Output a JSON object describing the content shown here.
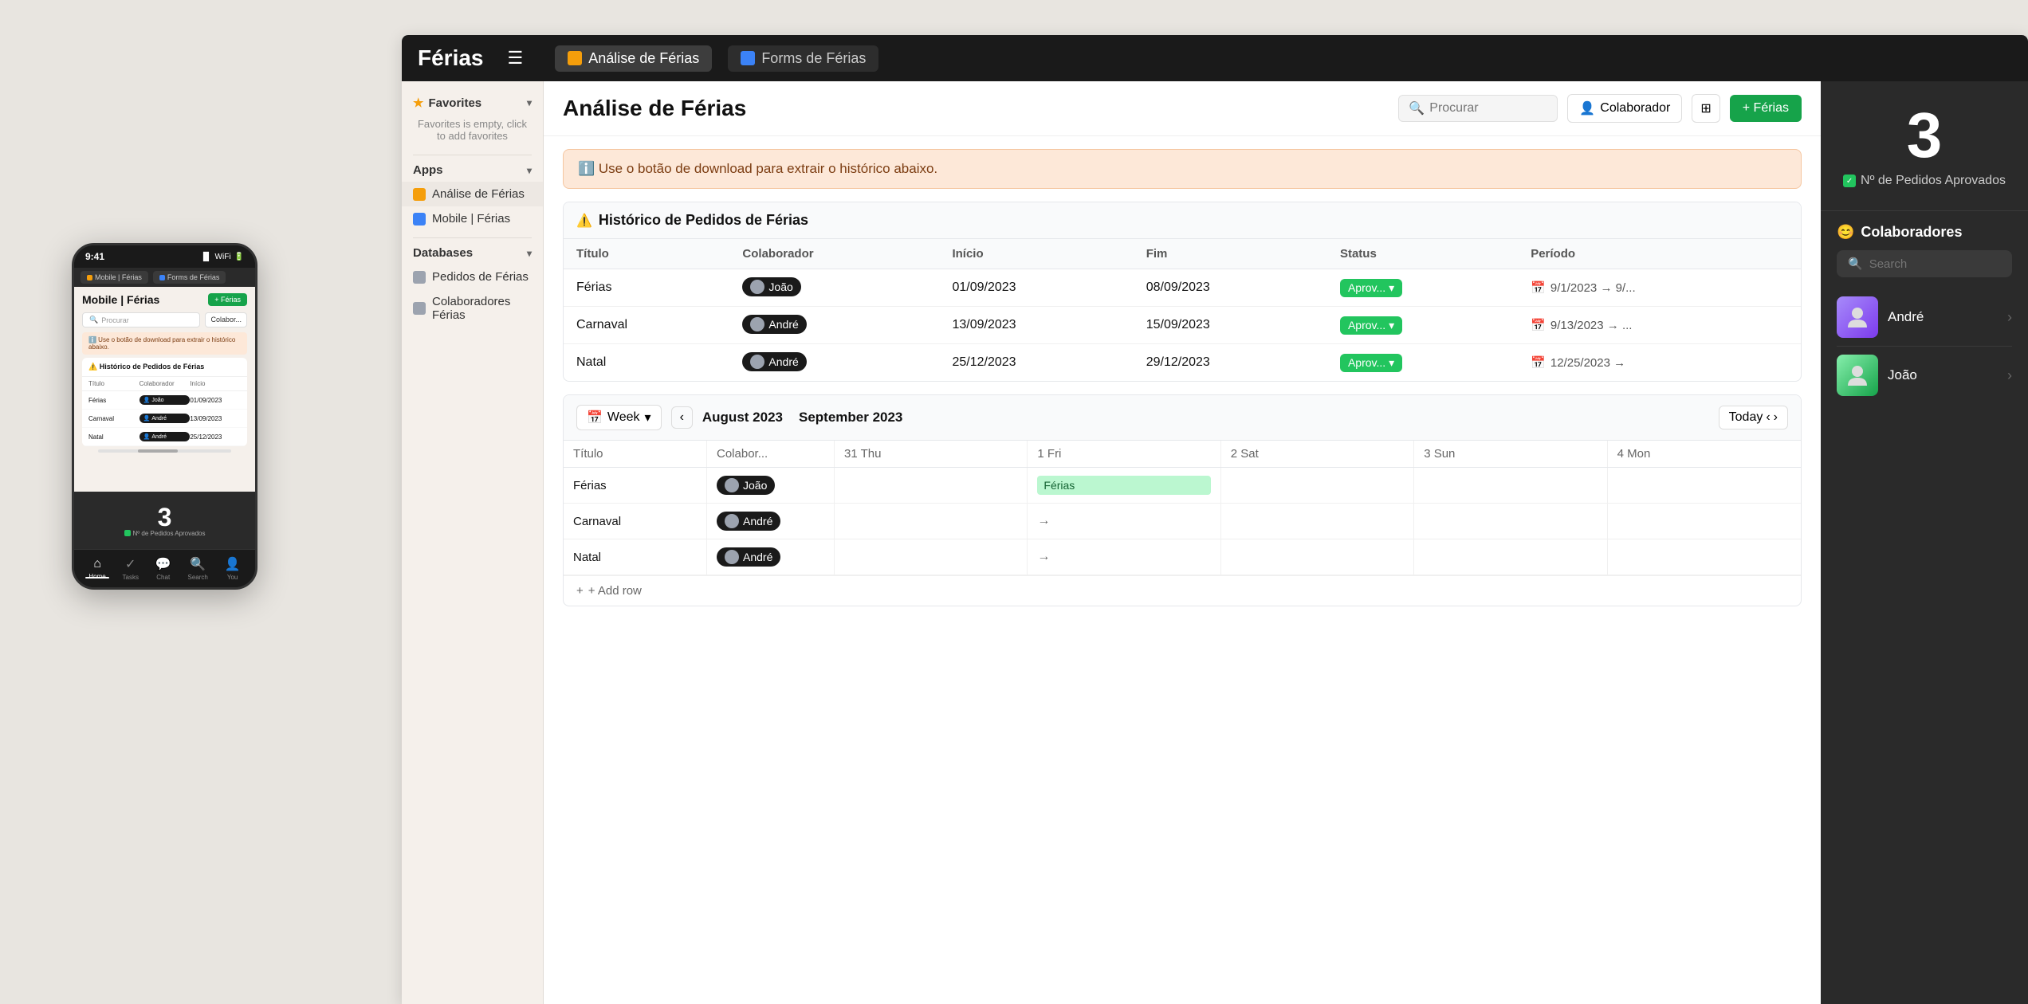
{
  "app": {
    "title": "Férias",
    "menu_icon": "☰",
    "tabs": [
      {
        "label": "Análise de Férias",
        "icon": "orange",
        "active": true
      },
      {
        "label": "Forms de Férias",
        "icon": "blue",
        "active": false
      }
    ]
  },
  "sidebar": {
    "favorites": {
      "label": "Favorites",
      "empty_text": "Favorites is empty, click to add favorites"
    },
    "apps": {
      "label": "Apps",
      "items": [
        {
          "label": "Análise de Férias",
          "icon": "orange",
          "active": true
        },
        {
          "label": "Mobile | Férias",
          "icon": "blue",
          "active": false
        }
      ]
    },
    "databases": {
      "label": "Databases",
      "items": [
        {
          "label": "Pedidos de Férias",
          "icon": "gray"
        },
        {
          "label": "Colaboradores Férias",
          "icon": "gray"
        }
      ]
    }
  },
  "page": {
    "title": "Análise de Férias",
    "search_placeholder": "Procurar",
    "btn_colaborador": "Colaborador",
    "btn_ferias": "+ Férias",
    "alert_text": "ℹ️ Use o botão de download para extrair o histórico abaixo.",
    "table": {
      "section_title": "Histórico de Pedidos de Férias",
      "columns": [
        "Título",
        "Colaborador",
        "Início",
        "Fim",
        "Status",
        "Período"
      ],
      "rows": [
        {
          "titulo": "Férias",
          "colaborador": "João",
          "inicio": "01/09/2023",
          "fim": "08/09/2023",
          "status": "Aprov...",
          "periodo": "9/1/2023 → 9/..."
        },
        {
          "titulo": "Carnaval",
          "colaborador": "André",
          "inicio": "13/09/2023",
          "fim": "15/09/2023",
          "status": "Aprov...",
          "periodo": "9/13/2023 → ..."
        },
        {
          "titulo": "Natal",
          "colaborador": "André",
          "inicio": "25/12/2023",
          "fim": "29/12/2023",
          "status": "Aprov...",
          "periodo": "12/25/2023 →"
        }
      ]
    },
    "calendar": {
      "week_label": "Week",
      "months": [
        "August 2023",
        "September 2023"
      ],
      "col_headers": [
        "Título",
        "Colabor...",
        "31 Thu",
        "1 Fri",
        "2 Sat",
        "3 Sun",
        "4 Mon"
      ],
      "rows": [
        {
          "titulo": "Férias",
          "colaborador": "João",
          "thu": "",
          "fri": "Férias",
          "sat": "",
          "sun": "",
          "mon": ""
        },
        {
          "titulo": "Carnaval",
          "colaborador": "André",
          "thu": "",
          "fri": "",
          "sat": "",
          "sun": "",
          "mon": ""
        },
        {
          "titulo": "Natal",
          "colaborador": "André",
          "thu": "",
          "fri": "",
          "sat": "",
          "sun": "",
          "mon": ""
        }
      ],
      "add_row_label": "+ Add row",
      "today_label": "Today"
    },
    "stats": {
      "number": "3",
      "label": "Nº de Pedidos Aprovados"
    },
    "colaboradores": {
      "title": "Colaboradores",
      "search_placeholder": "Search",
      "items": [
        {
          "name": "André",
          "avatar_emoji": "👨"
        },
        {
          "name": "João",
          "avatar_emoji": "👦"
        }
      ]
    }
  },
  "mobile": {
    "time": "9:41",
    "tab1": "Mobile | Férias",
    "tab2": "Forms de Férias",
    "page_title": "Mobile | Férias",
    "btn_ferias": "+ Férias",
    "search_placeholder": "Procurar",
    "btn_colaborador": "Colabor...",
    "alert_text": "ℹ️ Use o botão de download para extrair o histórico abaixo.",
    "table_title": "⚠️ Histórico de Pedidos de Férias",
    "table_headers": [
      "Título",
      "Colaborador",
      "Início"
    ],
    "rows": [
      {
        "titulo": "Férias",
        "colaborador": "João",
        "inicio": "01/09/2023"
      },
      {
        "titulo": "Carnaval",
        "colaborador": "André",
        "inicio": "13/09/2023"
      },
      {
        "titulo": "Natal",
        "colaborador": "André",
        "inicio": "25/12/2023"
      }
    ],
    "stats_number": "3",
    "stats_label": "Nº de Pedidos Aprovados",
    "nav_items": [
      "Home",
      "Tasks",
      "Chat",
      "Search",
      "You"
    ]
  }
}
